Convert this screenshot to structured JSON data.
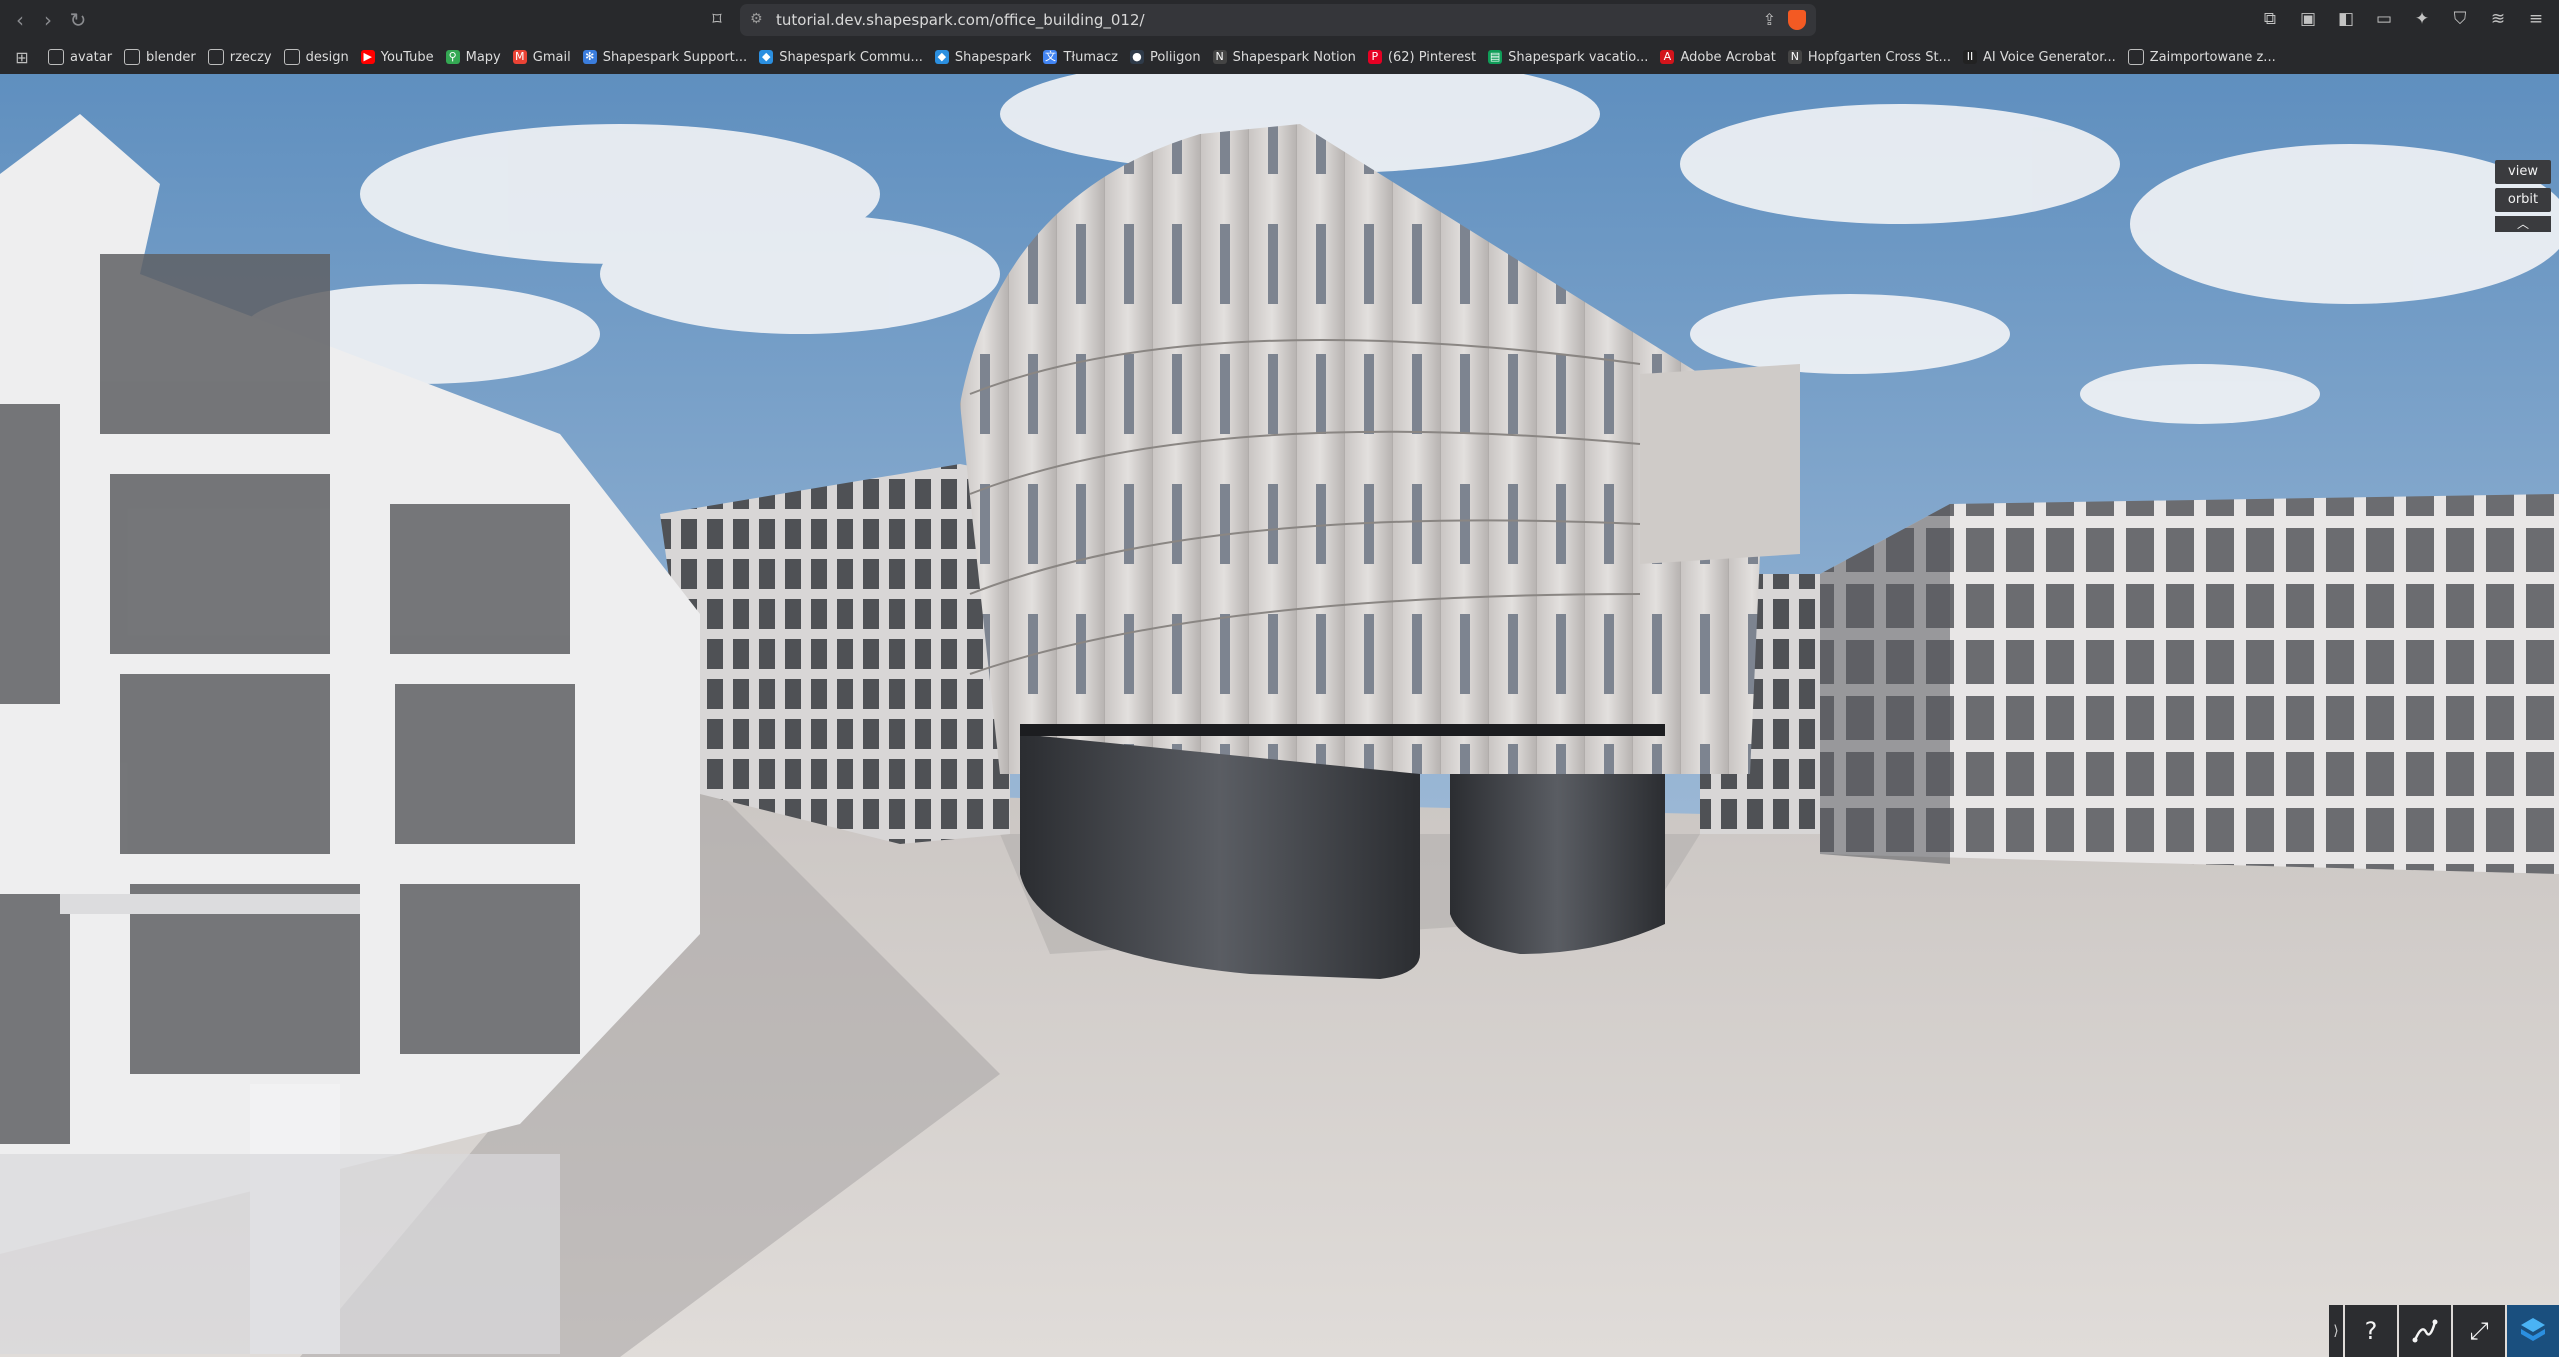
{
  "browser": {
    "url": "tutorial.dev.shapespark.com/office_building_012/",
    "bookmarks": [
      {
        "label": "avatar",
        "icon": "folder-icon",
        "color": "#bdbdbd"
      },
      {
        "label": "blender",
        "icon": "folder-icon",
        "color": "#bdbdbd"
      },
      {
        "label": "rzeczy",
        "icon": "folder-icon",
        "color": "#bdbdbd"
      },
      {
        "label": "design",
        "icon": "folder-icon",
        "color": "#bdbdbd"
      },
      {
        "label": "YouTube",
        "icon": "youtube-icon",
        "color": "#ff0000"
      },
      {
        "label": "Mapy",
        "icon": "maps-pin-icon",
        "color": "#34a853"
      },
      {
        "label": "Gmail",
        "icon": "gmail-icon",
        "color": "#ea4335"
      },
      {
        "label": "Shapespark Support...",
        "icon": "shapespark-support-icon",
        "color": "#3b7ddd"
      },
      {
        "label": "Shapespark Commu...",
        "icon": "shapespark-icon",
        "color": "#2b8fe0"
      },
      {
        "label": "Shapespark",
        "icon": "shapespark-icon",
        "color": "#2b8fe0"
      },
      {
        "label": "Tłumacz",
        "icon": "translate-icon",
        "color": "#4285f4"
      },
      {
        "label": "Poliigon",
        "icon": "poliigon-icon",
        "color": "#2f3b4a"
      },
      {
        "label": "Shapespark Notion",
        "icon": "notion-icon",
        "color": "#444444"
      },
      {
        "label": "(62) Pinterest",
        "icon": "pinterest-icon",
        "color": "#e60023"
      },
      {
        "label": "Shapespark vacatio...",
        "icon": "sheets-icon",
        "color": "#0f9d58"
      },
      {
        "label": "Adobe Acrobat",
        "icon": "acrobat-icon",
        "color": "#d3141b"
      },
      {
        "label": "Hopfgarten Cross St...",
        "icon": "notion-icon",
        "color": "#444444"
      },
      {
        "label": "AI Voice Generator...",
        "icon": "elevenlabs-icon",
        "color": "#222222"
      },
      {
        "label": "Zaimportowane z...",
        "icon": "folder-icon",
        "color": "#bdbdbd"
      }
    ]
  },
  "viewer": {
    "view_label": "view",
    "orbit_label": "orbit",
    "collapse_glyph": "︿",
    "help_glyph": "?",
    "toggle_glyph": "⟩"
  },
  "colors": {
    "chrome": "#28292c",
    "url_bar": "#35363a",
    "sky": "#7ea6c9",
    "ground": "#d6d1cd",
    "accent": "#2b8fe0"
  }
}
